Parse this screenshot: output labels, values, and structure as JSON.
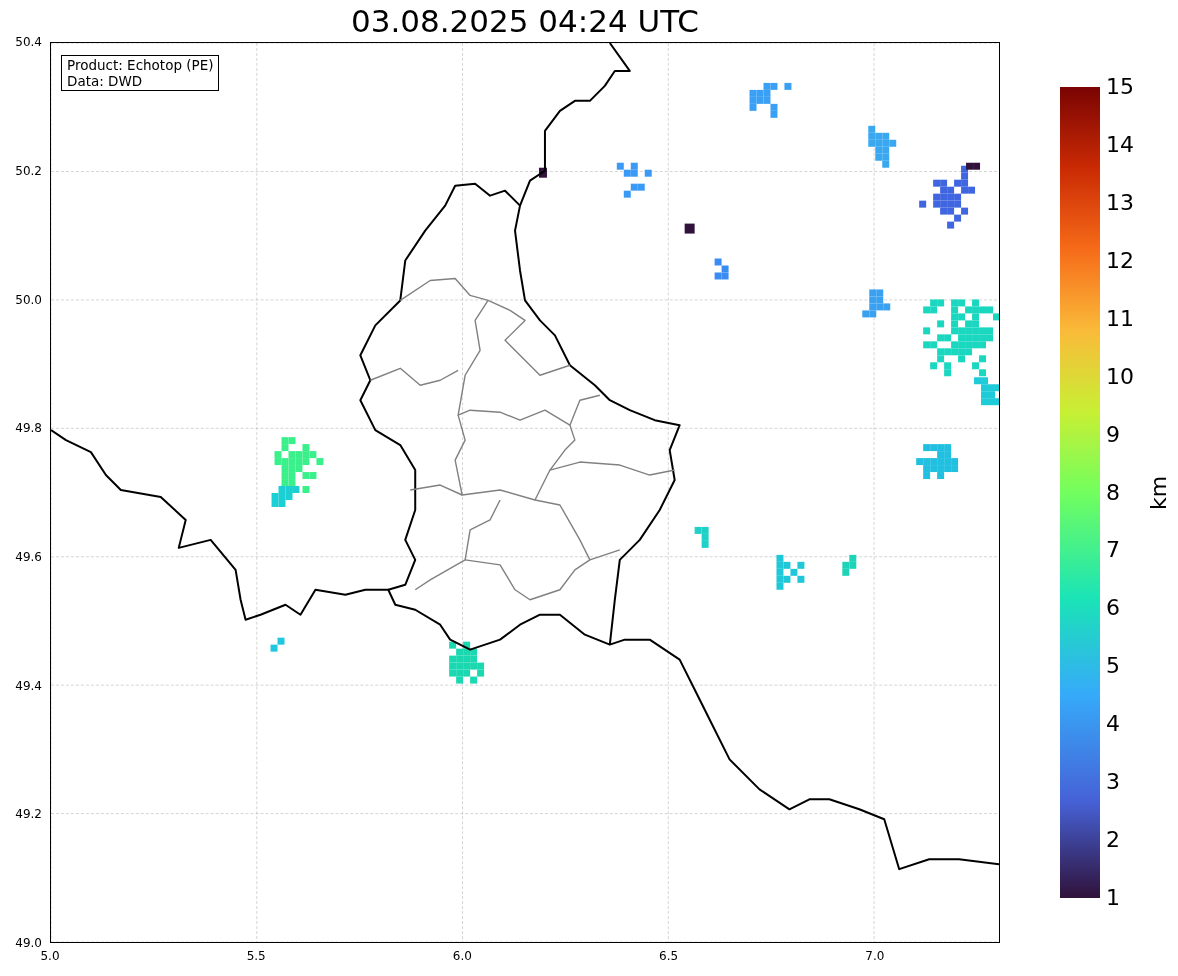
{
  "title": "03.08.2025 04:24 UTC",
  "info_box": [
    "Product: Echotop (PE)",
    "Data: DWD"
  ],
  "x_axis": {
    "ticks": [
      "5.0",
      "5.5",
      "6.0",
      "6.5",
      "7.0"
    ]
  },
  "y_axis": {
    "ticks": [
      "50.4",
      "50.2",
      "50.0",
      "49.8",
      "49.6",
      "49.4",
      "49.2",
      "49.0"
    ]
  },
  "colorbar": {
    "label": "km",
    "ticks": [
      "15",
      "14",
      "13",
      "12",
      "11",
      "10",
      "9",
      "8",
      "7",
      "6",
      "5",
      "4",
      "3",
      "2",
      "1"
    ]
  }
}
